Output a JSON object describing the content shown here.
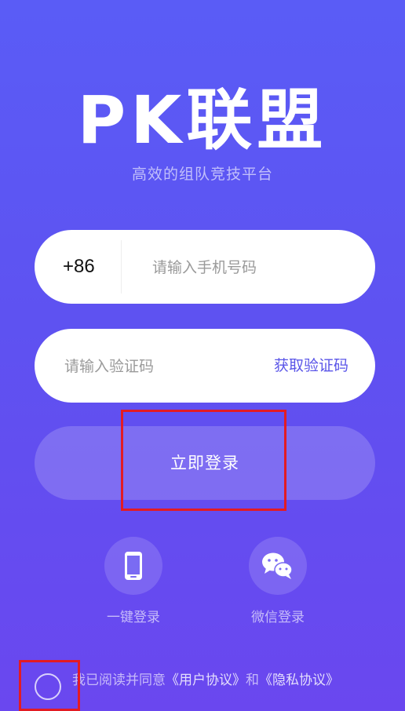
{
  "app": {
    "title": "PK联盟",
    "subtitle": "高效的组队竞技平台"
  },
  "phone": {
    "country_code": "+86",
    "placeholder": "请输入手机号码"
  },
  "code": {
    "placeholder": "请输入验证码",
    "get_code": "获取验证码"
  },
  "login": {
    "label": "立即登录"
  },
  "alt_login": [
    {
      "icon": "phone-icon",
      "label": "一键登录"
    },
    {
      "icon": "wechat-icon",
      "label": "微信登录"
    }
  ],
  "agreement": {
    "prefix": "我已阅读并同意",
    "user_agreement": "《用户协议》",
    "and": "和",
    "privacy": "《隐私协议》"
  },
  "colors": {
    "bg_top": "#5a5cf6",
    "bg_bottom": "#6a47ef",
    "accent": "#5a55e8",
    "highlight": "#e31b23"
  }
}
